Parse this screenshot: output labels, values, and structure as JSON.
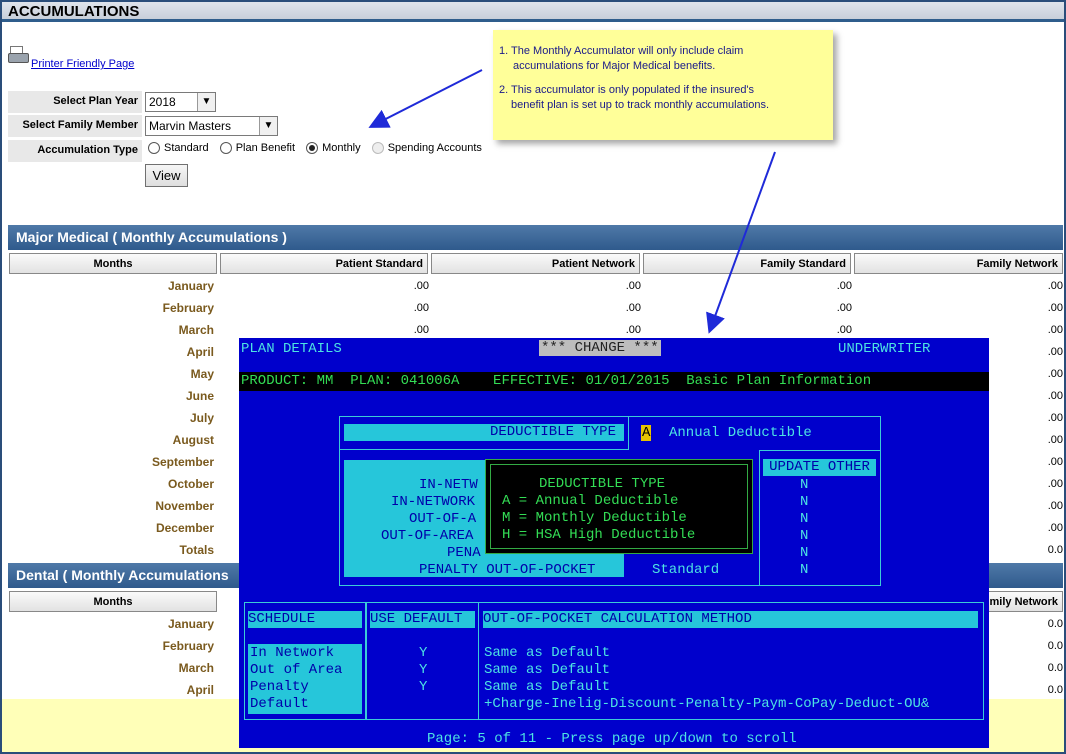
{
  "page": {
    "title": "ACCUMULATIONS",
    "printer_link": "Printer Friendly Page"
  },
  "form": {
    "plan_year_label": "Select Plan Year",
    "plan_year_value": "2018",
    "family_member_label": "Select Family Member",
    "family_member_value": "Marvin Masters",
    "accum_type_label": "Accumulation Type",
    "accum_types": [
      "Standard",
      "Plan Benefit",
      "Monthly",
      "Spending Accounts"
    ],
    "accum_type_selected": "Monthly",
    "view_button": "View"
  },
  "major_medical": {
    "title": "Major Medical ( Monthly Accumulations )",
    "columns": [
      "Months",
      "Patient Standard",
      "Patient Network",
      "Family Standard",
      "Family Network"
    ],
    "months": [
      "January",
      "February",
      "March",
      "April",
      "May",
      "June",
      "July",
      "August",
      "September",
      "October",
      "November",
      "December",
      "Totals"
    ],
    "visible_values": [
      [
        ".00",
        ".00",
        ".00",
        ".00"
      ],
      [
        ".00",
        ".00",
        ".00",
        ".00"
      ],
      [
        ".00",
        ".00",
        ".00",
        ".00"
      ]
    ],
    "right_col_values": [
      ".00",
      ".00",
      ".00",
      ".00",
      ".00",
      ".00",
      ".00",
      ".00",
      ".00",
      ".00",
      ".00",
      ".00",
      "0.0"
    ]
  },
  "dental": {
    "title": "Dental ( Monthly Accumulations",
    "col_months": "Months",
    "col_family_network": "mily Network",
    "months": [
      "January",
      "February",
      "March",
      "April"
    ],
    "right_col_values": [
      "0.0",
      "0.0",
      "0.0",
      "0.0"
    ]
  },
  "note": {
    "line1": "1. The Monthly Accumulator will only include claim",
    "line1b": "accumulations for Major Medical benefits.",
    "line2": "2. This accumulator is only populated if the insured's",
    "line2b": "benefit plan is set up to track monthly accumulations."
  },
  "terminal": {
    "header_left": "PLAN DETAILS",
    "header_center": "*** CHANGE ***",
    "header_right": "UNDERWRITER",
    "product_line": "PRODUCT: MM  PLAN: 041006A    EFFECTIVE: 01/01/2015  Basic Plan Information",
    "deductible_type_label": "DEDUCTIBLE TYPE",
    "deductible_type_code": "A",
    "deductible_type_desc": "Annual Deductible",
    "left_labels": [
      "IN-NETW",
      "IN-NETWORK",
      "OUT-OF-A",
      "OUT-OF-AREA",
      "PENA",
      "PENALTY OUT-OF-POCKET"
    ],
    "standard_label": "Standard",
    "update_other_label": "UPDATE OTHER",
    "update_other_values": [
      "N",
      "N",
      "N",
      "N",
      "N",
      "N"
    ],
    "popup_title": "DEDUCTIBLE TYPE",
    "popup_options": [
      "A = Annual Deductible",
      "M = Monthly Deductible",
      "H = HSA High Deductible"
    ],
    "schedule_header": "SCHEDULE",
    "use_default_header": "USE DEFAULT",
    "oop_header": "OUT-OF-POCKET CALCULATION METHOD",
    "schedule_rows": [
      "In Network",
      "Out of Area",
      "Penalty",
      "Default"
    ],
    "use_default_values": [
      "Y",
      "Y",
      "Y",
      ""
    ],
    "oop_values": [
      "Same as Default",
      "Same as Default",
      "Same as Default",
      "+Charge-Inelig-Discount-Penalty-Paym-CoPay-Deduct-OU&"
    ],
    "footer": "Page: 5 of 11 - Press page up/down to scroll"
  }
}
